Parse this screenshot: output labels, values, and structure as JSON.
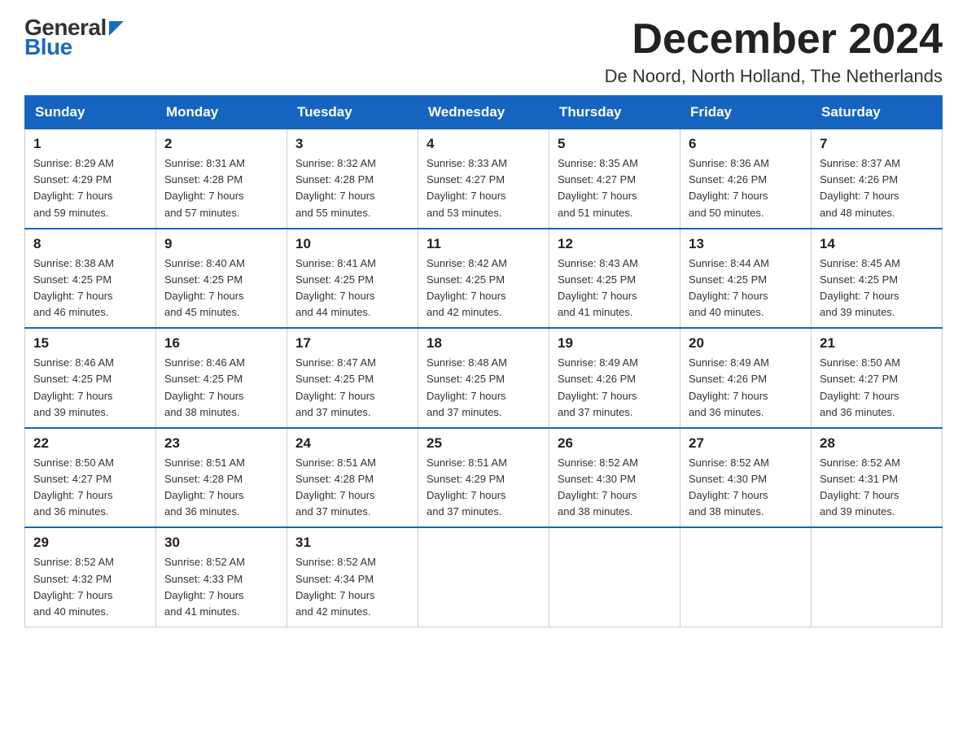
{
  "logo": {
    "text_general": "General",
    "text_blue": "Blue"
  },
  "header": {
    "title": "December 2024",
    "subtitle": "De Noord, North Holland, The Netherlands"
  },
  "weekdays": [
    "Sunday",
    "Monday",
    "Tuesday",
    "Wednesday",
    "Thursday",
    "Friday",
    "Saturday"
  ],
  "weeks": [
    [
      {
        "day": 1,
        "info": "Sunrise: 8:29 AM\nSunset: 4:29 PM\nDaylight: 7 hours\nand 59 minutes."
      },
      {
        "day": 2,
        "info": "Sunrise: 8:31 AM\nSunset: 4:28 PM\nDaylight: 7 hours\nand 57 minutes."
      },
      {
        "day": 3,
        "info": "Sunrise: 8:32 AM\nSunset: 4:28 PM\nDaylight: 7 hours\nand 55 minutes."
      },
      {
        "day": 4,
        "info": "Sunrise: 8:33 AM\nSunset: 4:27 PM\nDaylight: 7 hours\nand 53 minutes."
      },
      {
        "day": 5,
        "info": "Sunrise: 8:35 AM\nSunset: 4:27 PM\nDaylight: 7 hours\nand 51 minutes."
      },
      {
        "day": 6,
        "info": "Sunrise: 8:36 AM\nSunset: 4:26 PM\nDaylight: 7 hours\nand 50 minutes."
      },
      {
        "day": 7,
        "info": "Sunrise: 8:37 AM\nSunset: 4:26 PM\nDaylight: 7 hours\nand 48 minutes."
      }
    ],
    [
      {
        "day": 8,
        "info": "Sunrise: 8:38 AM\nSunset: 4:25 PM\nDaylight: 7 hours\nand 46 minutes."
      },
      {
        "day": 9,
        "info": "Sunrise: 8:40 AM\nSunset: 4:25 PM\nDaylight: 7 hours\nand 45 minutes."
      },
      {
        "day": 10,
        "info": "Sunrise: 8:41 AM\nSunset: 4:25 PM\nDaylight: 7 hours\nand 44 minutes."
      },
      {
        "day": 11,
        "info": "Sunrise: 8:42 AM\nSunset: 4:25 PM\nDaylight: 7 hours\nand 42 minutes."
      },
      {
        "day": 12,
        "info": "Sunrise: 8:43 AM\nSunset: 4:25 PM\nDaylight: 7 hours\nand 41 minutes."
      },
      {
        "day": 13,
        "info": "Sunrise: 8:44 AM\nSunset: 4:25 PM\nDaylight: 7 hours\nand 40 minutes."
      },
      {
        "day": 14,
        "info": "Sunrise: 8:45 AM\nSunset: 4:25 PM\nDaylight: 7 hours\nand 39 minutes."
      }
    ],
    [
      {
        "day": 15,
        "info": "Sunrise: 8:46 AM\nSunset: 4:25 PM\nDaylight: 7 hours\nand 39 minutes."
      },
      {
        "day": 16,
        "info": "Sunrise: 8:46 AM\nSunset: 4:25 PM\nDaylight: 7 hours\nand 38 minutes."
      },
      {
        "day": 17,
        "info": "Sunrise: 8:47 AM\nSunset: 4:25 PM\nDaylight: 7 hours\nand 37 minutes."
      },
      {
        "day": 18,
        "info": "Sunrise: 8:48 AM\nSunset: 4:25 PM\nDaylight: 7 hours\nand 37 minutes."
      },
      {
        "day": 19,
        "info": "Sunrise: 8:49 AM\nSunset: 4:26 PM\nDaylight: 7 hours\nand 37 minutes."
      },
      {
        "day": 20,
        "info": "Sunrise: 8:49 AM\nSunset: 4:26 PM\nDaylight: 7 hours\nand 36 minutes."
      },
      {
        "day": 21,
        "info": "Sunrise: 8:50 AM\nSunset: 4:27 PM\nDaylight: 7 hours\nand 36 minutes."
      }
    ],
    [
      {
        "day": 22,
        "info": "Sunrise: 8:50 AM\nSunset: 4:27 PM\nDaylight: 7 hours\nand 36 minutes."
      },
      {
        "day": 23,
        "info": "Sunrise: 8:51 AM\nSunset: 4:28 PM\nDaylight: 7 hours\nand 36 minutes."
      },
      {
        "day": 24,
        "info": "Sunrise: 8:51 AM\nSunset: 4:28 PM\nDaylight: 7 hours\nand 37 minutes."
      },
      {
        "day": 25,
        "info": "Sunrise: 8:51 AM\nSunset: 4:29 PM\nDaylight: 7 hours\nand 37 minutes."
      },
      {
        "day": 26,
        "info": "Sunrise: 8:52 AM\nSunset: 4:30 PM\nDaylight: 7 hours\nand 38 minutes."
      },
      {
        "day": 27,
        "info": "Sunrise: 8:52 AM\nSunset: 4:30 PM\nDaylight: 7 hours\nand 38 minutes."
      },
      {
        "day": 28,
        "info": "Sunrise: 8:52 AM\nSunset: 4:31 PM\nDaylight: 7 hours\nand 39 minutes."
      }
    ],
    [
      {
        "day": 29,
        "info": "Sunrise: 8:52 AM\nSunset: 4:32 PM\nDaylight: 7 hours\nand 40 minutes."
      },
      {
        "day": 30,
        "info": "Sunrise: 8:52 AM\nSunset: 4:33 PM\nDaylight: 7 hours\nand 41 minutes."
      },
      {
        "day": 31,
        "info": "Sunrise: 8:52 AM\nSunset: 4:34 PM\nDaylight: 7 hours\nand 42 minutes."
      },
      null,
      null,
      null,
      null
    ]
  ]
}
